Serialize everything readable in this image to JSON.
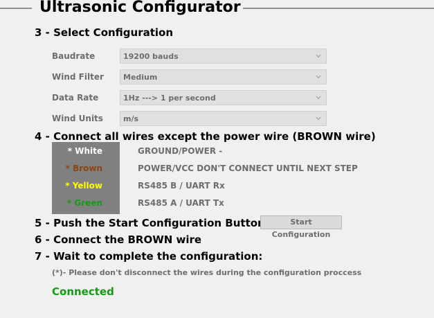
{
  "header": {
    "title": "Ultrasonic Configurator"
  },
  "steps": {
    "step3": "3 - Select Configuration",
    "step4": "4 - Connect all wires except the power wire (BROWN wire)",
    "step5": "5 - Push the Start Configuration Button:",
    "step6": "6 - Connect the BROWN wire",
    "step7": "7 - Wait to complete the configuration:"
  },
  "config": {
    "baudrate": {
      "label": "Baudrate",
      "value": "19200 bauds"
    },
    "windfilter": {
      "label": "Wind Filter",
      "value": "Medium"
    },
    "datarate": {
      "label": "Data Rate",
      "value": "1Hz ---> 1 per second"
    },
    "windunits": {
      "label": "Wind Units",
      "value": "m/s"
    }
  },
  "wires": [
    {
      "name": "* White",
      "color": "#ffffff",
      "desc": "GROUND/POWER -"
    },
    {
      "name": "* Brown",
      "color": "#8b4513",
      "desc": "POWER/VCC DON'T CONNECT UNTIL NEXT STEP"
    },
    {
      "name": "* Yellow",
      "color": "#ffff00",
      "desc": "RS485 B / UART Rx"
    },
    {
      "name": "* Green",
      "color": "#159a15",
      "desc": "RS485 A / UART Tx"
    }
  ],
  "start_button": {
    "label": "Start Configuration"
  },
  "note": "(*)- Please don't disconnect the wires during the configuration proccess",
  "status": {
    "text": "Connected",
    "color": "#159a15"
  }
}
